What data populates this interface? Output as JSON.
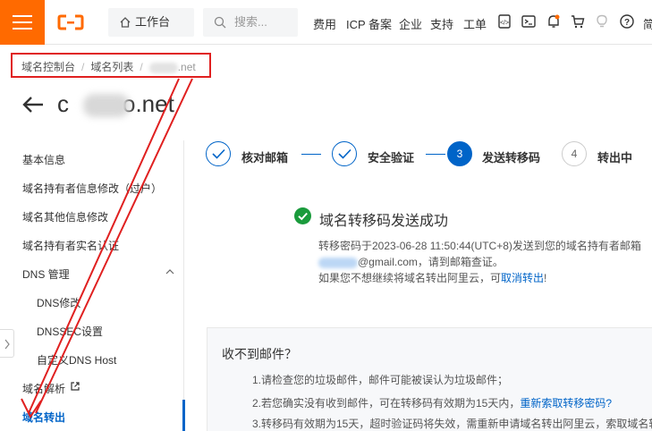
{
  "topbar": {
    "workbench_label": "工作台",
    "search_placeholder": "搜索...",
    "nav": [
      "费用",
      "ICP 备案",
      "企业",
      "支持",
      "工单"
    ],
    "truncated_text": "简"
  },
  "breadcrumb": {
    "items": [
      "域名控制台",
      "域名列表"
    ],
    "current_suffix": ".net"
  },
  "header": {
    "domain_prefix": "c",
    "domain_suffix": "o.net"
  },
  "sidebar": {
    "items": [
      "基本信息",
      "域名持有者信息修改（过户）",
      "域名其他信息修改",
      "域名持有者实名认证",
      "DNS 管理",
      "DNS修改",
      "DNSSEC设置",
      "自定义DNS Host",
      "域名解析",
      "域名转出"
    ],
    "active_index": 9
  },
  "steps": [
    {
      "label": "核对邮箱",
      "state": "done"
    },
    {
      "label": "安全验证",
      "state": "done"
    },
    {
      "number": "3",
      "label": "发送转移码",
      "state": "current"
    },
    {
      "number": "4",
      "label": "转出中",
      "state": "pending"
    }
  ],
  "success": {
    "title": "域名转移码发送成功",
    "line1": "转移密码于2023-06-28 11:50:44(UTC+8)发送到您的域名持有者邮箱",
    "line2_suffix": "@gmail.com，请到邮箱查证。",
    "line3_prefix": "如果您不想继续将域名转出阿里云，可",
    "cancel_link": "取消转出",
    "line3_suffix": "!"
  },
  "help": {
    "title": "收不到邮件？",
    "item1": "1.请检查您的垃圾邮件，邮件可能被误认为垃圾邮件；",
    "item2_prefix": "2.若您确实没有收到邮件，可在转移码有效期为15天内，",
    "item2_link": "重新索取转移密码?",
    "item3": "3.转移码有效期为15天，超时验证码将失效，需重新申请域名转出阿里云，索取域名转"
  },
  "colors": {
    "brand": "#ff6a00",
    "accent": "#0064c8",
    "success": "#1a9b3c",
    "annotation": "#e02020"
  }
}
